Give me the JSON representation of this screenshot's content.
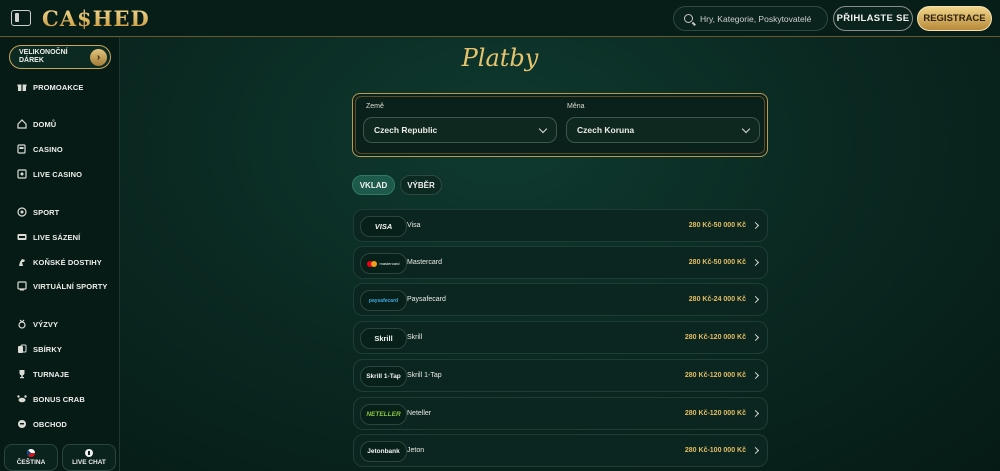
{
  "header": {
    "logo": "CA$HED",
    "search_placeholder": "Hry, Kategorie, Poskytovatelé",
    "login_label": "PŘIHLASTE SE",
    "register_label": "REGISTRACE"
  },
  "sidebar": {
    "gift_line1": "VELIKONOČNÍ",
    "gift_line2": "DÁREK",
    "items": [
      {
        "label": "PROMOAKCE",
        "icon": "gift-icon"
      },
      {
        "label": "DOMŮ",
        "icon": "home-icon"
      },
      {
        "label": "CASINO",
        "icon": "slot-machine-icon"
      },
      {
        "label": "LIVE CASINO",
        "icon": "live-casino-icon"
      },
      {
        "label": "SPORT",
        "icon": "soccer-ball-icon"
      },
      {
        "label": "LIVE SÁZENÍ",
        "icon": "live-betting-icon"
      },
      {
        "label": "KOŇSKÉ DOSTIHY",
        "icon": "horse-icon"
      },
      {
        "label": "VIRTUÁLNÍ SPORTY",
        "icon": "virtual-sports-icon"
      },
      {
        "label": "VÝZVY",
        "icon": "medal-icon"
      },
      {
        "label": "SBÍRKY",
        "icon": "cards-icon"
      },
      {
        "label": "TURNAJE",
        "icon": "trophy-icon"
      },
      {
        "label": "BONUS CRAB",
        "icon": "crab-icon"
      },
      {
        "label": "OBCHOD",
        "icon": "shop-icon"
      }
    ],
    "language_label": "ČEŠTINA",
    "chat_label": "LIVE CHAT"
  },
  "main": {
    "title": "Platby",
    "country_label": "Země",
    "country_value": "Czech Republic",
    "currency_label": "Měna",
    "currency_value": "Czech Koruna",
    "tab_deposit": "VKLAD",
    "tab_withdraw": "VÝBĚR",
    "payments": [
      {
        "logo": "VISA",
        "name": "Visa",
        "range": "280 Kč-50 000 Kč"
      },
      {
        "logo": "mastercard",
        "name": "Mastercard",
        "range": "280 Kč-50 000 Kč"
      },
      {
        "logo": "paysafecard",
        "name": "Paysafecard",
        "range": "280 Kč-24 000 Kč"
      },
      {
        "logo": "Skrill",
        "name": "Skrill",
        "range": "280 Kč-120 000 Kč"
      },
      {
        "logo": "Skrill 1-Tap",
        "name": "Skrill 1-Tap",
        "range": "280 Kč-120 000 Kč"
      },
      {
        "logo": "NETELLER",
        "name": "Neteller",
        "range": "280 Kč-120 000 Kč"
      },
      {
        "logo": "Jetonbank",
        "name": "Jeton",
        "range": "280 Kč-100 000 Kč"
      }
    ]
  },
  "colors": {
    "gold": "#e3bd62",
    "background": "#0a2a22",
    "active_tab": "#1d5a4b"
  }
}
